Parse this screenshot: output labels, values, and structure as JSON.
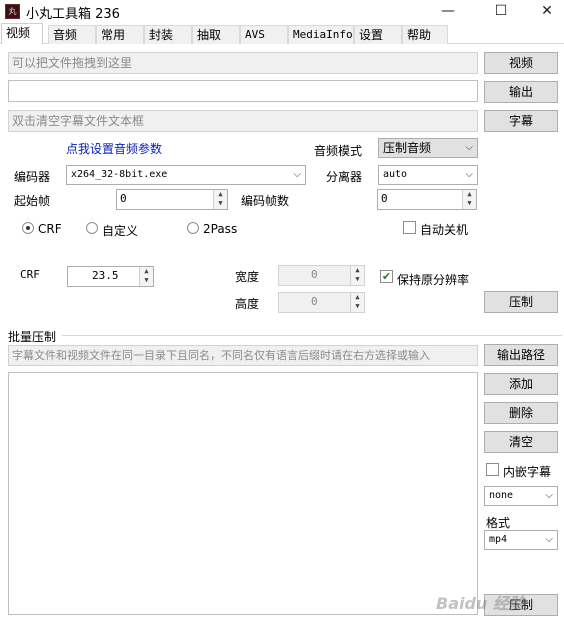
{
  "window": {
    "title": "小丸工具箱 236",
    "icon_text": "丸",
    "minimize_glyph": "—",
    "maximize_glyph": "☐",
    "close_glyph": "✕"
  },
  "tabs": [
    "视频",
    "音频",
    "常用",
    "封装",
    "抽取",
    "AVS",
    "MediaInfo",
    "设置",
    "帮助"
  ],
  "inputs": {
    "drop_hint": "可以把文件拖拽到这里",
    "output_path": "",
    "subtitle_hint": "双击清空字幕文件文本框"
  },
  "buttons": {
    "video": "视频",
    "output": "输出",
    "subtitle": "字幕",
    "compress": "压制",
    "output_dir": "输出路径",
    "add": "添加",
    "delete": "删除",
    "clear": "清空",
    "batch_compress": "压制"
  },
  "audio": {
    "settings_link": "点我设置音频参数",
    "mode_label": "音频模式",
    "mode_value": "压制音频"
  },
  "encoder": {
    "label": "编码器",
    "value": "x264_32-8bit.exe",
    "demuxer_label": "分离器",
    "demuxer_value": "auto"
  },
  "frames": {
    "start_label": "起始帧",
    "start_value": "0",
    "count_label": "编码帧数",
    "count_value": "0",
    "auto_shutdown": "自动关机"
  },
  "rate_modes": {
    "crf": "CRF",
    "custom": "自定义",
    "twopass": "2Pass",
    "selected": "crf"
  },
  "crf": {
    "label": "CRF",
    "value": "23.5"
  },
  "resolution": {
    "width_label": "宽度",
    "width_value": "0",
    "height_label": "高度",
    "height_value": "0",
    "keep_label": "保持原分辨率",
    "keep_checked": true
  },
  "batch": {
    "section_title": "批量压制",
    "path_hint": "字幕文件和视频文件在同一目录下且同名，不同名仅有语言后缀时请在右方选择或输入",
    "embed_subs": "内嵌字幕",
    "lang_value": "none",
    "format_label": "格式",
    "format_value": "mp4"
  },
  "watermark": "Baidu 经验"
}
